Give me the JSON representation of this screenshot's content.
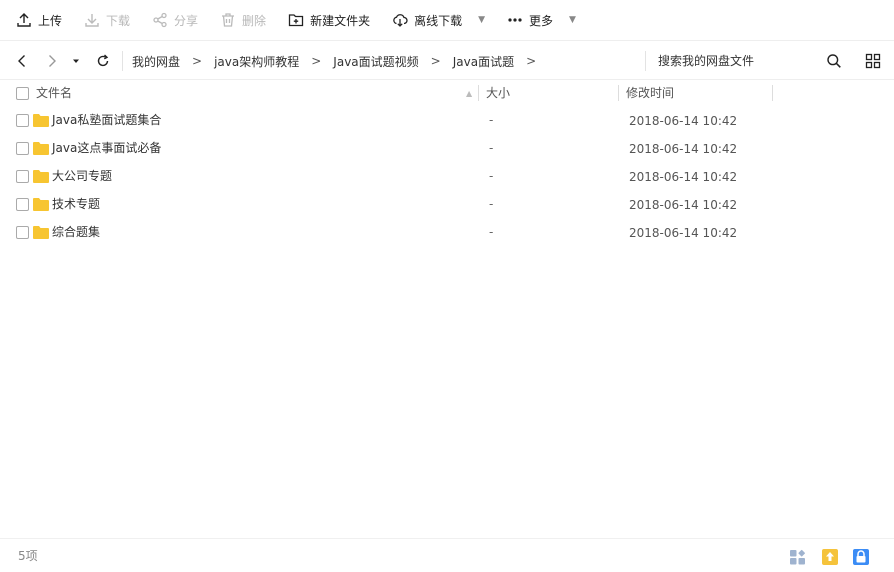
{
  "toolbar": {
    "upload": "上传",
    "download": "下载",
    "share": "分享",
    "delete": "删除",
    "new_folder": "新建文件夹",
    "offline_download": "离线下载",
    "more": "更多"
  },
  "breadcrumb": [
    "我的网盘",
    "java架构师教程",
    "Java面试题视频",
    "Java面试题"
  ],
  "search": {
    "placeholder": "搜索我的网盘文件"
  },
  "columns": {
    "name": "文件名",
    "size": "大小",
    "modified": "修改时间"
  },
  "files": [
    {
      "name": "Java私塾面试题集合",
      "size": "-",
      "modified": "2018-06-14 10:42"
    },
    {
      "name": "Java这点事面试必备",
      "size": "-",
      "modified": "2018-06-14 10:42"
    },
    {
      "name": "大公司专题",
      "size": "-",
      "modified": "2018-06-14 10:42"
    },
    {
      "name": "技术专题",
      "size": "-",
      "modified": "2018-06-14 10:42"
    },
    {
      "name": "综合题集",
      "size": "-",
      "modified": "2018-06-14 10:42"
    }
  ],
  "status": {
    "count": "5项"
  },
  "colors": {
    "folder": "#f7c531",
    "accent": "#3b8cf5",
    "upload_badge": "#f5c33b"
  }
}
